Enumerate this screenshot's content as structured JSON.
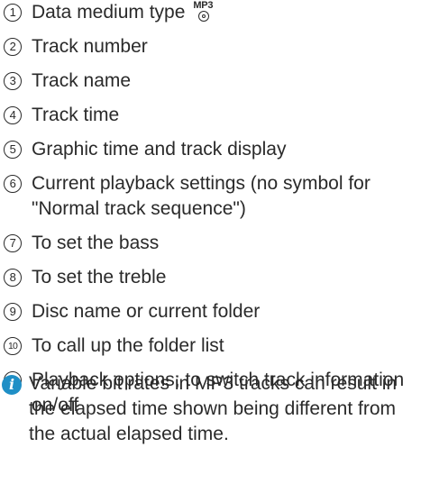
{
  "items": [
    {
      "marker": "1",
      "text": "Data medium type",
      "icon": "mp3-disc-icon",
      "icon_label": "MP3"
    },
    {
      "marker": "2",
      "text": "Track number"
    },
    {
      "marker": "3",
      "text": "Track name"
    },
    {
      "marker": "4",
      "text": "Track time"
    },
    {
      "marker": "5",
      "text": "Graphic time and track display"
    },
    {
      "marker": "6",
      "text": "Current playback settings (no symbol for \"Normal track sequence\")"
    },
    {
      "marker": "7",
      "text": "To set the bass"
    },
    {
      "marker": "8",
      "text": "To set the treble"
    },
    {
      "marker": "9",
      "text": "Disc name or current folder"
    },
    {
      "marker": "10",
      "text": "To call up the folder list"
    },
    {
      "marker": "11",
      "text": "Playback options; to switch track information on/off"
    }
  ],
  "note": {
    "icon": "info-icon",
    "icon_glyph": "i",
    "icon_color": "#1f8fc6",
    "text": "Variable bit rates in MP3 tracks can result in the elapsed time shown being different from the actual elapsed time."
  }
}
